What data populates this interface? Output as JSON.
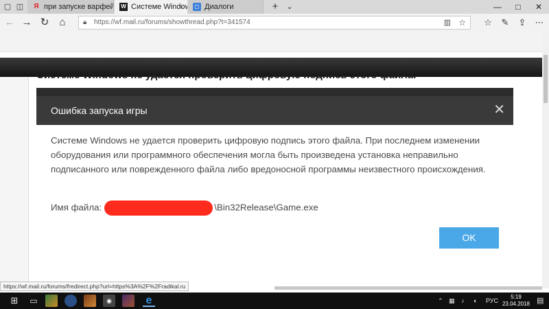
{
  "browser": {
    "tabs": [
      {
        "favicon": "Я",
        "label": "при запуске варфейс ошиб",
        "active": false
      },
      {
        "favicon": "W",
        "label": "Системе Windows не у",
        "active": true
      },
      {
        "favicon": "chat-icon",
        "label": "Диалоги",
        "active": false
      }
    ],
    "tab_close": "×",
    "new_tab": "+",
    "tab_list": "⌄",
    "url": "https://wf.mail.ru/forums/showthread.php?t=341574"
  },
  "page": {
    "post_title": "Системе Windows не удается проверить цифровую подпись этого файла."
  },
  "dialog": {
    "title": "Ошибка запуска игры",
    "body": "Системе Windows не удается проверить цифровую подпись этого файла. При последнем изменении оборудования или программного обеспечения могла быть произведена установка неправильно подписанного или поврежденного файла либо вредоносной программы неизвестного происхождения.",
    "file_label": "Имя файла:",
    "file_path": "\\Bin32Release\\Game.exe",
    "ok_label": "OK",
    "accent_color": "#4aa7e8",
    "redaction_color": "#ff2b1c"
  },
  "status_bar": {
    "link_url": "https://wf.mail.ru/forums/fredirect.php?url=https%3A%2F%2Fradikal.ru"
  },
  "taskbar": {
    "language": "РУС",
    "time": "5:19",
    "date": "23.04.2018"
  }
}
